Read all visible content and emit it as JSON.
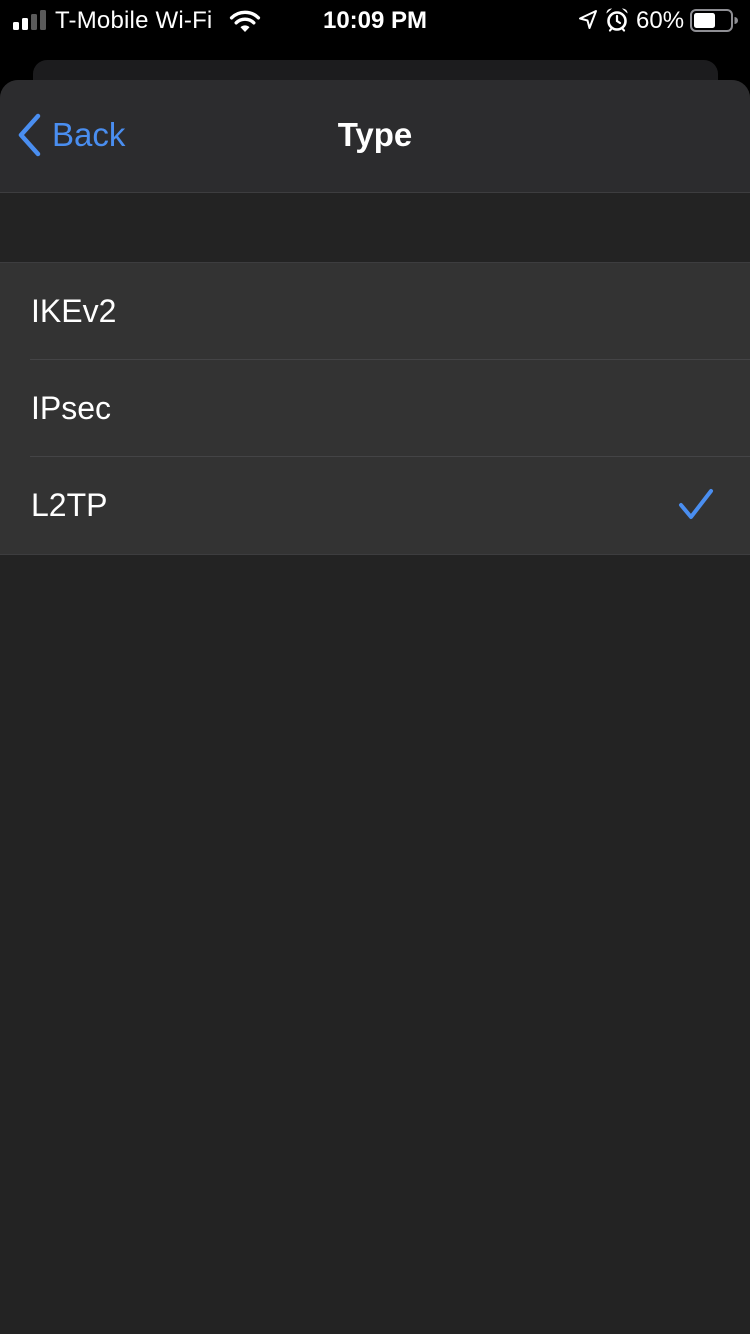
{
  "status_bar": {
    "carrier": "T-Mobile Wi-Fi",
    "time": "10:09 PM",
    "battery_percent": "60%",
    "battery_level": 0.6,
    "signal_bars": 2,
    "signal_bars_total": 4,
    "icons": [
      "signal-icon",
      "wifi-icon",
      "location-icon",
      "alarm-icon",
      "battery-icon"
    ]
  },
  "nav": {
    "back_label": "Back",
    "title": "Type"
  },
  "options": [
    {
      "label": "IKEv2",
      "selected": false
    },
    {
      "label": "IPsec",
      "selected": false
    },
    {
      "label": "L2TP",
      "selected": true
    }
  ],
  "colors": {
    "accent": "#4a8ef0",
    "background": "#232323",
    "nav_background": "#2c2c2e",
    "cell_background": "#333333"
  }
}
